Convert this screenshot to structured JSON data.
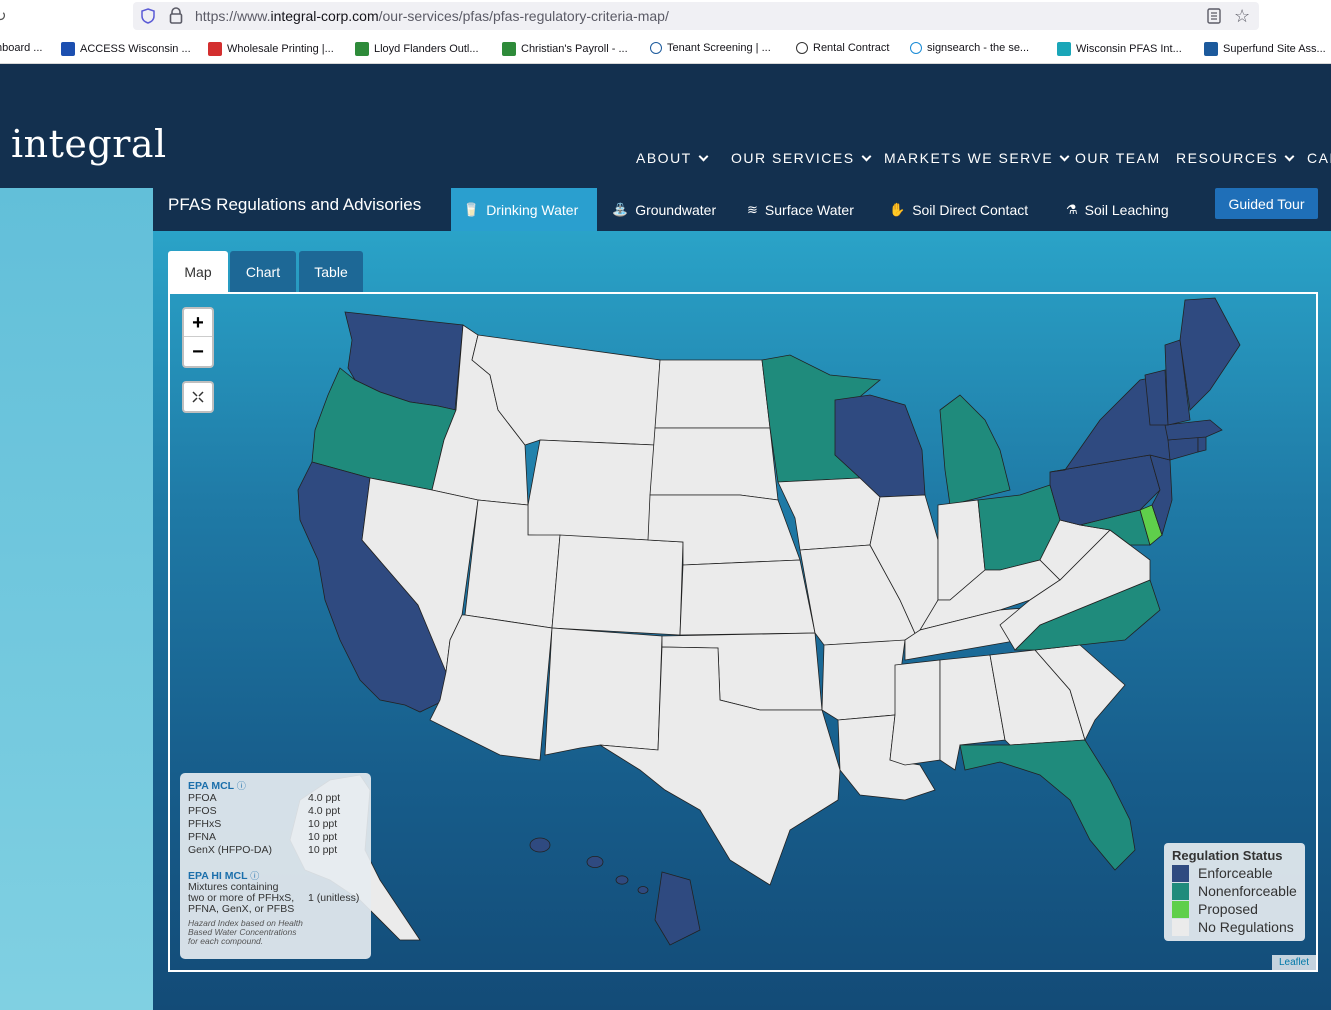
{
  "browser": {
    "url_prefix": "https://www.",
    "url_domain": "integral-corp.com",
    "url_path": "/our-services/pfas/pfas-regulatory-criteria-map/",
    "bookmarks": [
      {
        "label": "hboard ...",
        "icon": "none",
        "color": "#ffffff"
      },
      {
        "label": "ACCESS Wisconsin ...",
        "icon": "access-icon",
        "color": "#1c4fb0"
      },
      {
        "label": "Wholesale Printing |...",
        "icon": "printing-icon",
        "color": "#d32f2f"
      },
      {
        "label": "Lloyd Flanders Outl...",
        "icon": "lloyd-icon",
        "color": "#2e8b3a"
      },
      {
        "label": "Christian's Payroll - ...",
        "icon": "payroll-icon",
        "color": "#2e8b3a"
      },
      {
        "label": "Tenant Screening | ...",
        "icon": "screening-icon",
        "color": "#1c5a9c"
      },
      {
        "label": "Rental Contract",
        "icon": "globe-icon",
        "color": "#333333"
      },
      {
        "label": "signsearch - the se...",
        "icon": "sign-icon",
        "color": "#1a8bd6"
      },
      {
        "label": "Wisconsin PFAS Int...",
        "icon": "pfas-icon",
        "color": "#1aa6b8"
      },
      {
        "label": "Superfund Site Ass...",
        "icon": "superfund-icon",
        "color": "#1c5a9c"
      }
    ]
  },
  "site": {
    "logo": "integral",
    "nav": [
      {
        "label": "ABOUT",
        "dropdown": true
      },
      {
        "label": "OUR SERVICES",
        "dropdown": true
      },
      {
        "label": "MARKETS WE SERVE",
        "dropdown": true
      },
      {
        "label": "OUR TEAM",
        "dropdown": false
      },
      {
        "label": "RESOURCES",
        "dropdown": true
      },
      {
        "label": "CAR",
        "dropdown": false
      }
    ]
  },
  "subnav": {
    "title": "PFAS Regulations and Advisories",
    "tabs": [
      {
        "label": "Drinking Water",
        "icon": "drinking-water-icon",
        "active": true
      },
      {
        "label": "Groundwater",
        "icon": "groundwater-icon",
        "active": false
      },
      {
        "label": "Surface Water",
        "icon": "surface-water-icon",
        "active": false
      },
      {
        "label": "Soil Direct Contact",
        "icon": "soil-contact-icon",
        "active": false
      },
      {
        "label": "Soil Leaching",
        "icon": "soil-leaching-icon",
        "active": false
      }
    ],
    "guided_tour": "Guided Tour"
  },
  "view_tabs": [
    "Map",
    "Chart",
    "Table"
  ],
  "map": {
    "zoom_in": "+",
    "zoom_out": "−",
    "attribution": "Leaflet",
    "epa": {
      "mcl_title": "EPA MCL",
      "mcl_rows": [
        {
          "name": "PFOA",
          "value": "4.0 ppt"
        },
        {
          "name": "PFOS",
          "value": "4.0 ppt"
        },
        {
          "name": "PFHxS",
          "value": "10 ppt"
        },
        {
          "name": "PFNA",
          "value": "10 ppt"
        },
        {
          "name": "GenX (HFPO-DA)",
          "value": "10 ppt"
        }
      ],
      "hi_title": "EPA HI MCL",
      "hi_text_1": "Mixtures containing",
      "hi_text_2": "two or more of PFHxS,",
      "hi_text_3": "PFNA, GenX, or PFBS",
      "hi_value": "1 (unitless)",
      "note_1": "Hazard Index based on Health",
      "note_2": "Based Water Concentrations",
      "note_3": "for each compound."
    },
    "legend": {
      "title": "Regulation Status",
      "items": [
        {
          "label": "Enforceable",
          "color": "#2f4a80"
        },
        {
          "label": "Nonenforceable",
          "color": "#1f8b7c"
        },
        {
          "label": "Proposed",
          "color": "#5fcf4b"
        },
        {
          "label": "No Regulations",
          "color": "#ebebeb"
        }
      ]
    },
    "state_status": {
      "WA": "Enforceable",
      "OR": "Nonenforceable",
      "CA": "Enforceable",
      "ID": "No Regulations",
      "NV": "No Regulations",
      "MT": "No Regulations",
      "WY": "No Regulations",
      "UT": "No Regulations",
      "AZ": "No Regulations",
      "CO": "No Regulations",
      "NM": "No Regulations",
      "ND": "No Regulations",
      "SD": "No Regulations",
      "NE": "No Regulations",
      "KS": "No Regulations",
      "OK": "No Regulations",
      "TX": "No Regulations",
      "MN": "Nonenforceable",
      "IA": "No Regulations",
      "MO": "No Regulations",
      "AR": "No Regulations",
      "LA": "No Regulations",
      "WI": "Enforceable",
      "IL": "No Regulations",
      "MI": "Nonenforceable",
      "IN": "No Regulations",
      "OH": "Nonenforceable",
      "KY": "No Regulations",
      "TN": "No Regulations",
      "MS": "No Regulations",
      "AL": "No Regulations",
      "GA": "No Regulations",
      "FL": "Nonenforceable",
      "SC": "No Regulations",
      "NC": "Nonenforceable",
      "VA": "No Regulations",
      "WV": "No Regulations",
      "MD": "Nonenforceable",
      "DE": "Proposed",
      "PA": "Enforceable",
      "NJ": "Enforceable",
      "NY": "Enforceable",
      "CT": "Enforceable",
      "RI": "Enforceable",
      "MA": "Enforceable",
      "VT": "Enforceable",
      "NH": "Enforceable",
      "ME": "Enforceable",
      "AK": "No Regulations",
      "HI": "Enforceable"
    }
  }
}
